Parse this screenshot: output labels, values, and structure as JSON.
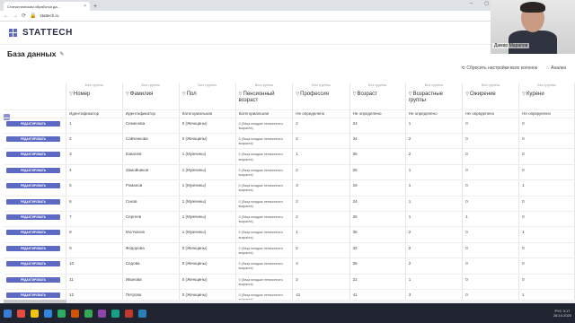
{
  "browser": {
    "tab_title": "Статистическая обработка да...",
    "url": "stattech.ru"
  },
  "app": {
    "logo_text": "STATTECH"
  },
  "page": {
    "title": "База данных"
  },
  "toolbar": {
    "reset_label": "Сбросить настройки всех колонок",
    "analysis_label": "Анализ"
  },
  "webcam": {
    "name": "Дамир Марапов"
  },
  "table": {
    "group_label": "Без группы",
    "edit_label": "РЕДАКТИРОВАТЬ",
    "columns": [
      {
        "title": "Номер",
        "type": "Идентификатор"
      },
      {
        "title": "Фамилия",
        "type": "Идентификатор"
      },
      {
        "title": "Пол",
        "type": "Категориальная"
      },
      {
        "title": "Пенсионный возраст",
        "type": "Категориальная"
      },
      {
        "title": "Профессия",
        "type": "Не определено"
      },
      {
        "title": "Возраст",
        "type": "Не определено"
      },
      {
        "title": "Возрастные группы",
        "type": "Не определено"
      },
      {
        "title": "Ожирение",
        "type": "Не определено"
      },
      {
        "title": "Курени",
        "type": "Не определено"
      }
    ],
    "rows": [
      [
        "1",
        "Семенова",
        "0 (Женщины)",
        "0 (Лица младше пенсионного возраста)",
        "2",
        "24",
        "1",
        "0",
        "0"
      ],
      [
        "2",
        "Савченкова",
        "0 (Женщины)",
        "0 (Лица младше пенсионного возраста)",
        "2",
        "34",
        "2",
        "0",
        "0"
      ],
      [
        "3",
        "Ковалев",
        "1 (Мужчины)",
        "0 (Лица младше пенсионного возраста)",
        "1",
        "35",
        "2",
        "0",
        "0"
      ],
      [
        "4",
        "Замойников",
        "1 (Мужчины)",
        "0 (Лица младше пенсионного возраста)",
        "2",
        "25",
        "1",
        "0",
        "0"
      ],
      [
        "5",
        "Романов",
        "1 (Мужчины)",
        "0 (Лица младше пенсионного возраста)",
        "3",
        "19",
        "1",
        "0",
        "1"
      ],
      [
        "6",
        "Снков",
        "1 (Мужчины)",
        "0 (Лица младше пенсионного возраста)",
        "2",
        "24",
        "1",
        "0",
        "0"
      ],
      [
        "7",
        "Сергеев",
        "1 (Мужчины)",
        "0 (Лица младше пенсионного возраста)",
        "2",
        "26",
        "1",
        "1",
        "0"
      ],
      [
        "8",
        "Молчанов",
        "1 (Мужчины)",
        "0 (Лица младше пенсионного возраста)",
        "1",
        "36",
        "2",
        "0",
        "1"
      ],
      [
        "9",
        "Федорова",
        "0 (Женщины)",
        "0 (Лица младше пенсионного возраста)",
        "2",
        "32",
        "2",
        "0",
        "0"
      ],
      [
        "10",
        "Седова",
        "0 (Женщины)",
        "0 (Лица младше пенсионного возраста)",
        "4",
        "35",
        "2",
        "0",
        "0"
      ],
      [
        "11",
        "Иванова",
        "0 (Женщины)",
        "0 (Лица младше пенсионного возраста)",
        "2",
        "22",
        "1",
        "0",
        "0"
      ],
      [
        "12",
        "Петрова",
        "0 (Женщины)",
        "0 (Лица младше пенсионного возраста)",
        "41",
        "41",
        "3",
        "0",
        "1"
      ]
    ]
  },
  "taskbar": {
    "time": "3:17",
    "date": "28.10.2020",
    "lang": "РУС"
  },
  "colors": {
    "accent": "#5c6ac4",
    "taskbar": "#1f2430"
  }
}
